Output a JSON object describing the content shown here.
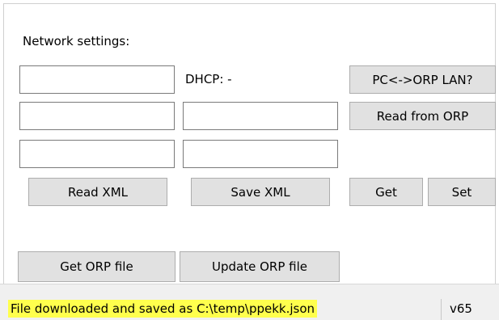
{
  "network": {
    "section_label": "Network settings:",
    "dhcp_label": "DHCP: -",
    "fields": {
      "r1c1": "",
      "r2c1": "",
      "r2c2": "",
      "r3c1": "",
      "r3c2": ""
    }
  },
  "buttons": {
    "pc_orp_lan": "PC<->ORP LAN?",
    "read_from_orp": "Read from ORP",
    "read_xml": "Read XML",
    "save_xml": "Save XML",
    "get": "Get",
    "set": "Set",
    "get_orp_file": "Get ORP file",
    "update_orp_file": "Update ORP file"
  },
  "status": {
    "message": "File downloaded and saved as C:\\temp\\ppekk.json",
    "highlight_color": "#ffff4d",
    "version": "v65"
  }
}
